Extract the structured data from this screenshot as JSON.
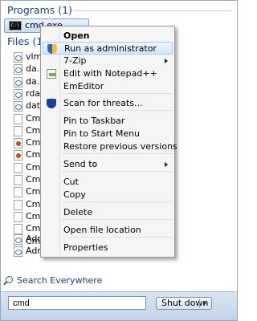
{
  "start_menu": {
    "programs_header": "Programs (1)",
    "program_item": "cmd.exe",
    "files_header": "Files (101",
    "files": [
      {
        "label": "vlm_c",
        "kind": "script"
      },
      {
        "label": "da.cr",
        "kind": "script"
      },
      {
        "label": "da.cr",
        "kind": "script"
      },
      {
        "label": "rda.c",
        "kind": "script"
      },
      {
        "label": "date_",
        "kind": "script"
      },
      {
        "label": "Cmd",
        "kind": "doc"
      },
      {
        "label": "Cmd",
        "kind": "doc"
      },
      {
        "label": "Cmd",
        "kind": "bat"
      },
      {
        "label": "Cmd",
        "kind": "bat"
      },
      {
        "label": "Cmd",
        "kind": "doc"
      },
      {
        "label": "Cmd",
        "kind": "doc"
      },
      {
        "label": "Cmd",
        "kind": "doc"
      },
      {
        "label": "Cmd",
        "kind": "doc"
      },
      {
        "label": "Cmd",
        "kind": "doc"
      },
      {
        "label": "Cmd",
        "kind": "doc"
      },
      {
        "label": "Cmd",
        "kind": "doc"
      },
      {
        "label": "Admi",
        "kind": "script"
      }
    ],
    "last_file": "Adminstur.cmd",
    "search_everywhere": "Search Everywhere",
    "search_value": "cmd",
    "shutdown_label": "Shut down"
  },
  "context_menu": {
    "items": [
      {
        "label": "Open",
        "bold": true,
        "icon": ""
      },
      {
        "label": "Run as administrator",
        "icon": "uac-shield-icon",
        "highlighted": true
      },
      {
        "label": "7-Zip",
        "submenu": true
      },
      {
        "label": "Edit with Notepad++",
        "icon": "notepad-plus-icon"
      },
      {
        "label": "EmEditor"
      },
      {
        "label": "Scan for threats...",
        "icon": "defender-shield-icon"
      },
      {
        "label": "Pin to Taskbar"
      },
      {
        "label": "Pin to Start Menu"
      },
      {
        "label": "Restore previous versions"
      },
      {
        "label": "Send to",
        "submenu": true
      },
      {
        "label": "Cut"
      },
      {
        "label": "Copy"
      },
      {
        "label": "Delete"
      },
      {
        "label": "Open file location"
      },
      {
        "label": "Properties"
      }
    ]
  }
}
